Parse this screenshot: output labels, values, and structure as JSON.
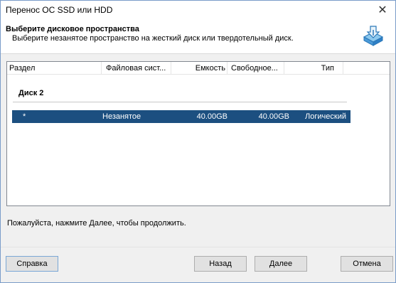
{
  "window": {
    "title": "Перенос ОС SSD или HDD"
  },
  "header": {
    "title": "Выберите дисковое пространства",
    "subtitle": "Выберите незанятое пространство на жесткий диск или твердотельный диск.",
    "icon": "disk-migrate-icon"
  },
  "table": {
    "columns": [
      "Раздел",
      "Файловая сист...",
      "Емкость",
      "Свободное...",
      "Тип"
    ],
    "group": "Диск 2",
    "rows": [
      {
        "partition": "*",
        "filesystem": "Незанятое",
        "capacity": "40.00GB",
        "free": "40.00GB",
        "type": "Логический"
      }
    ]
  },
  "status": "Пожалуйста, нажмите Далее, чтобы продолжить.",
  "buttons": {
    "help": "Справка",
    "back": "Назад",
    "next": "Далее",
    "cancel": "Отмена"
  },
  "colors": {
    "selection": "#1c4f80",
    "accent": "#1e7bc0"
  }
}
